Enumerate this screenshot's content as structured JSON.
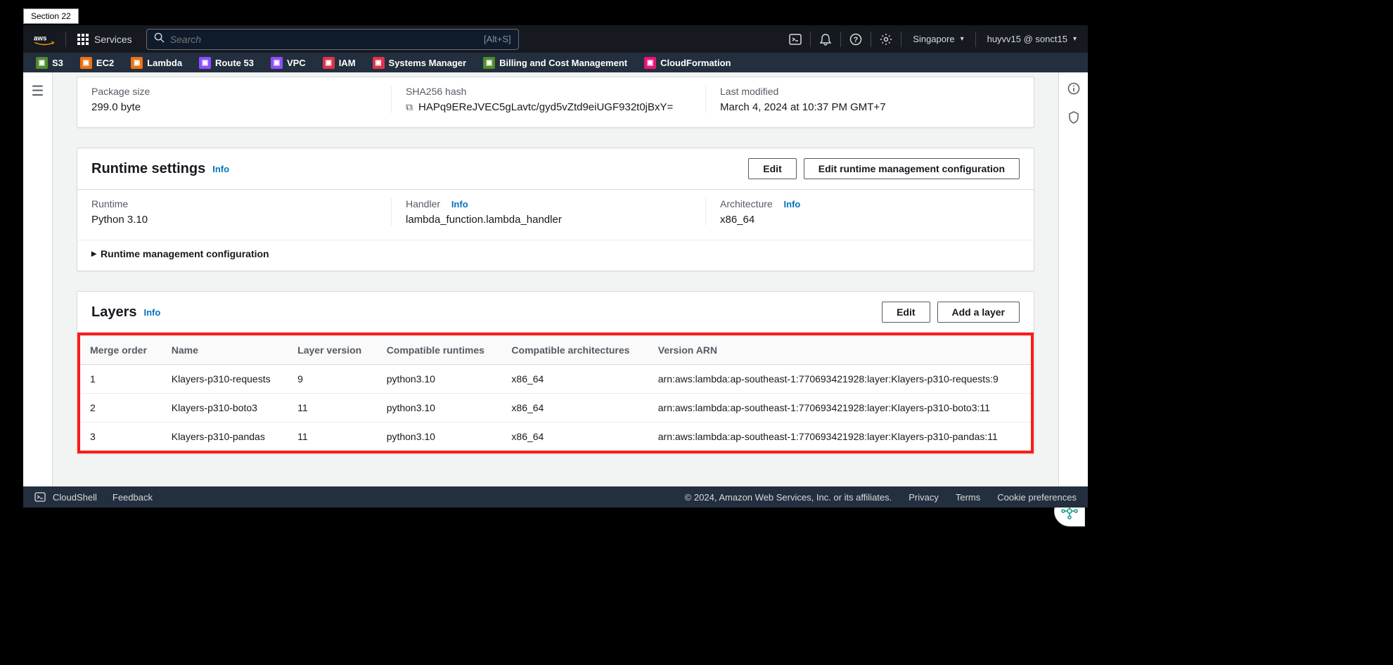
{
  "section_tab": "Section 22",
  "topbar": {
    "services": "Services",
    "search_placeholder": "Search",
    "shortcut": "[Alt+S]",
    "region": "Singapore",
    "user": "huyvv15 @ sonct15"
  },
  "favorites": [
    {
      "label": "S3",
      "color": "#4f8c2c"
    },
    {
      "label": "EC2",
      "color": "#ed7211"
    },
    {
      "label": "Lambda",
      "color": "#ed7211"
    },
    {
      "label": "Route 53",
      "color": "#8c4fff"
    },
    {
      "label": "VPC",
      "color": "#8c4fff"
    },
    {
      "label": "IAM",
      "color": "#dd344c"
    },
    {
      "label": "Systems Manager",
      "color": "#dd344c"
    },
    {
      "label": "Billing and Cost Management",
      "color": "#4f8c2c"
    },
    {
      "label": "CloudFormation",
      "color": "#e7157b"
    }
  ],
  "info_label": "Info",
  "package_panel": {
    "cols": [
      {
        "label": "Package size",
        "value": "299.0 byte",
        "copy": false
      },
      {
        "label": "SHA256 hash",
        "value": "HAPq9EReJVEC5gLavtc/gyd5vZtd9eiUGF932t0jBxY=",
        "copy": true
      },
      {
        "label": "Last modified",
        "value": "March 4, 2024 at 10:37 PM GMT+7",
        "copy": false
      }
    ]
  },
  "runtime_panel": {
    "title": "Runtime settings",
    "edit_btn": "Edit",
    "edit_mgmt_btn": "Edit runtime management configuration",
    "cols": [
      {
        "label": "Runtime",
        "value": "Python 3.10",
        "info": false
      },
      {
        "label": "Handler",
        "value": "lambda_function.lambda_handler",
        "info": true
      },
      {
        "label": "Architecture",
        "value": "x86_64",
        "info": true
      }
    ],
    "expand": "Runtime management configuration"
  },
  "layers_panel": {
    "title": "Layers",
    "edit_btn": "Edit",
    "add_btn": "Add a layer",
    "headers": [
      "Merge order",
      "Name",
      "Layer version",
      "Compatible runtimes",
      "Compatible architectures",
      "Version ARN"
    ],
    "rows": [
      {
        "order": "1",
        "name": "Klayers-p310-requests",
        "ver": "9",
        "rt": "python3.10",
        "arch": "x86_64",
        "arn": "arn:aws:lambda:ap-southeast-1:770693421928:layer:Klayers-p310-requests:9"
      },
      {
        "order": "2",
        "name": "Klayers-p310-boto3",
        "ver": "11",
        "rt": "python3.10",
        "arch": "x86_64",
        "arn": "arn:aws:lambda:ap-southeast-1:770693421928:layer:Klayers-p310-boto3:11"
      },
      {
        "order": "3",
        "name": "Klayers-p310-pandas",
        "ver": "11",
        "rt": "python3.10",
        "arch": "x86_64",
        "arn": "arn:aws:lambda:ap-southeast-1:770693421928:layer:Klayers-p310-pandas:11"
      }
    ]
  },
  "footer": {
    "cloudshell": "CloudShell",
    "feedback": "Feedback",
    "copyright": "© 2024, Amazon Web Services, Inc. or its affiliates.",
    "links": [
      "Privacy",
      "Terms",
      "Cookie preferences"
    ]
  }
}
